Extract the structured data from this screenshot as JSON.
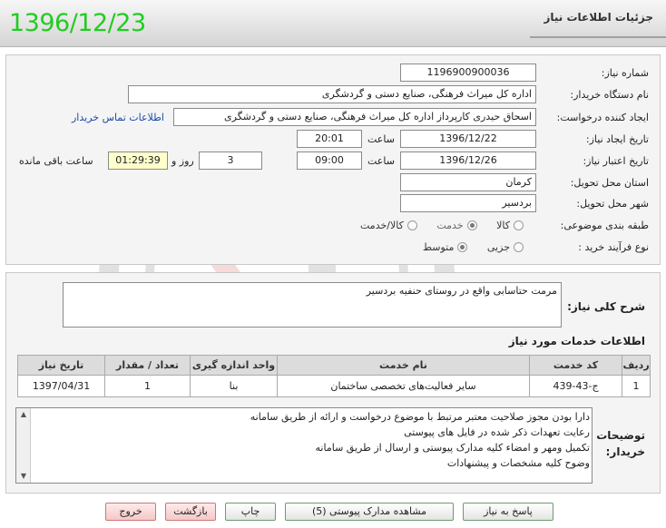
{
  "header": {
    "date": "1396/12/23",
    "title": "جزئیات اطلاعات نیاز"
  },
  "form": {
    "need_number": {
      "label": "شماره نیاز:",
      "value": "1196900900036"
    },
    "buyer_org": {
      "label": "نام دستگاه خریدار:",
      "value": "اداره کل میراث فرهنگی، صنایع دستی و گردشگری"
    },
    "requester": {
      "label": "ایجاد کننده درخواست:",
      "value": "اسحاق حیدری کارپرداز اداره کل میراث فرهنگی، صنایع دستی و گردشگری",
      "contact_link": "اطلاعات تماس خریدار"
    },
    "created": {
      "label": "تاریخ ایجاد نیاز:",
      "date": "1396/12/22",
      "time_label": "ساعت",
      "time": "20:01"
    },
    "validity": {
      "label": "تاریخ اعتبار نیاز:",
      "date": "1396/12/26",
      "time_label": "ساعت",
      "time": "09:00",
      "days": "3",
      "days_label": "روز و",
      "timer": "01:29:39",
      "remaining_label": "ساعت باقی مانده"
    },
    "province": {
      "label": "استان محل تحویل:",
      "value": "کرمان"
    },
    "city": {
      "label": "شهر محل تحویل:",
      "value": "بردسیر"
    },
    "category": {
      "label": "طبقه بندی موضوعی:",
      "options": [
        "کالا",
        "خدمت",
        "کالا/خدمت"
      ],
      "selected": "خدمت"
    },
    "purchase_type": {
      "label": "نوع فرآیند خرید :",
      "options": [
        "جزیی",
        "متوسط"
      ],
      "selected": "متوسط"
    }
  },
  "description": {
    "label": "شرح کلی نیاز:",
    "value": "مرمت حتاسابی واقع در روستای حنفیه بردسیر"
  },
  "services": {
    "title": "اطلاعات خدمات مورد نیاز",
    "columns": [
      "ردیف",
      "کد خدمت",
      "نام خدمت",
      "واحد اندازه گیری",
      "تعداد / مقدار",
      "تاریخ نیاز"
    ],
    "rows": [
      [
        "1",
        "ج-43-439",
        "سایر فعالیت‌های تخصصی ساختمان",
        "بنا",
        "1",
        "1397/04/31"
      ]
    ]
  },
  "buyer_notes": {
    "label_line1": "توضیحات",
    "label_line2": "خریدار:",
    "lines": [
      "دارا بودن مجوز صلاحیت معتبر مرتبط با موضوع درخواست و ارائه از طریق سامانه",
      "رعایت تعهدات ذکر شده در فایل های پیوستی",
      " تکمیل  ومهر و امضاء کلیه مدارک پیوستی و ارسال از طریق سامانه",
      "وضوح کلیه مشخصات و پیشنهادات"
    ]
  },
  "buttons": {
    "reply": "پاسخ به نیاز",
    "attachments": "مشاهده مدارک پیوستی (5)",
    "print": "چاپ",
    "back": "بازگشت",
    "exit": "خروج"
  }
}
